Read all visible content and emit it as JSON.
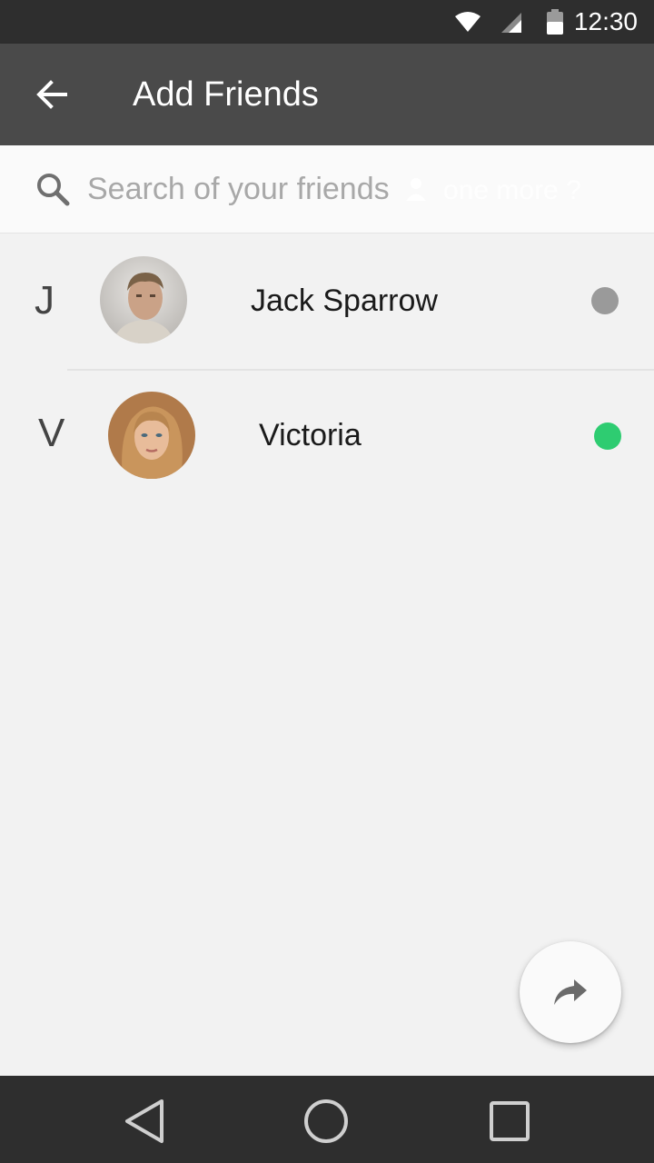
{
  "status_bar": {
    "time": "12:30",
    "icons": [
      "wifi-icon",
      "cell-signal-icon",
      "battery-icon"
    ]
  },
  "app_bar": {
    "title": "Add Friends",
    "back_icon": "arrow-left-icon"
  },
  "search": {
    "placeholder": "Search of your friends",
    "value": "",
    "icon": "search-icon",
    "ghost_text": "one more ?"
  },
  "friends": [
    {
      "letter": "J",
      "name": "Jack Sparrow",
      "status": "offline",
      "status_color": "#9a9a9a"
    },
    {
      "letter": "V",
      "name": "Victoria",
      "status": "online",
      "status_color": "#2ecc71"
    }
  ],
  "fab": {
    "icon": "share-arrow-icon"
  },
  "nav_bar": {
    "icons": [
      "nav-back-icon",
      "nav-home-icon",
      "nav-recents-icon"
    ]
  },
  "colors": {
    "app_bar": "#4a4a4a",
    "status_bar": "#2e2e2e",
    "background": "#f2f2f2",
    "online": "#2ecc71",
    "offline": "#9a9a9a"
  }
}
